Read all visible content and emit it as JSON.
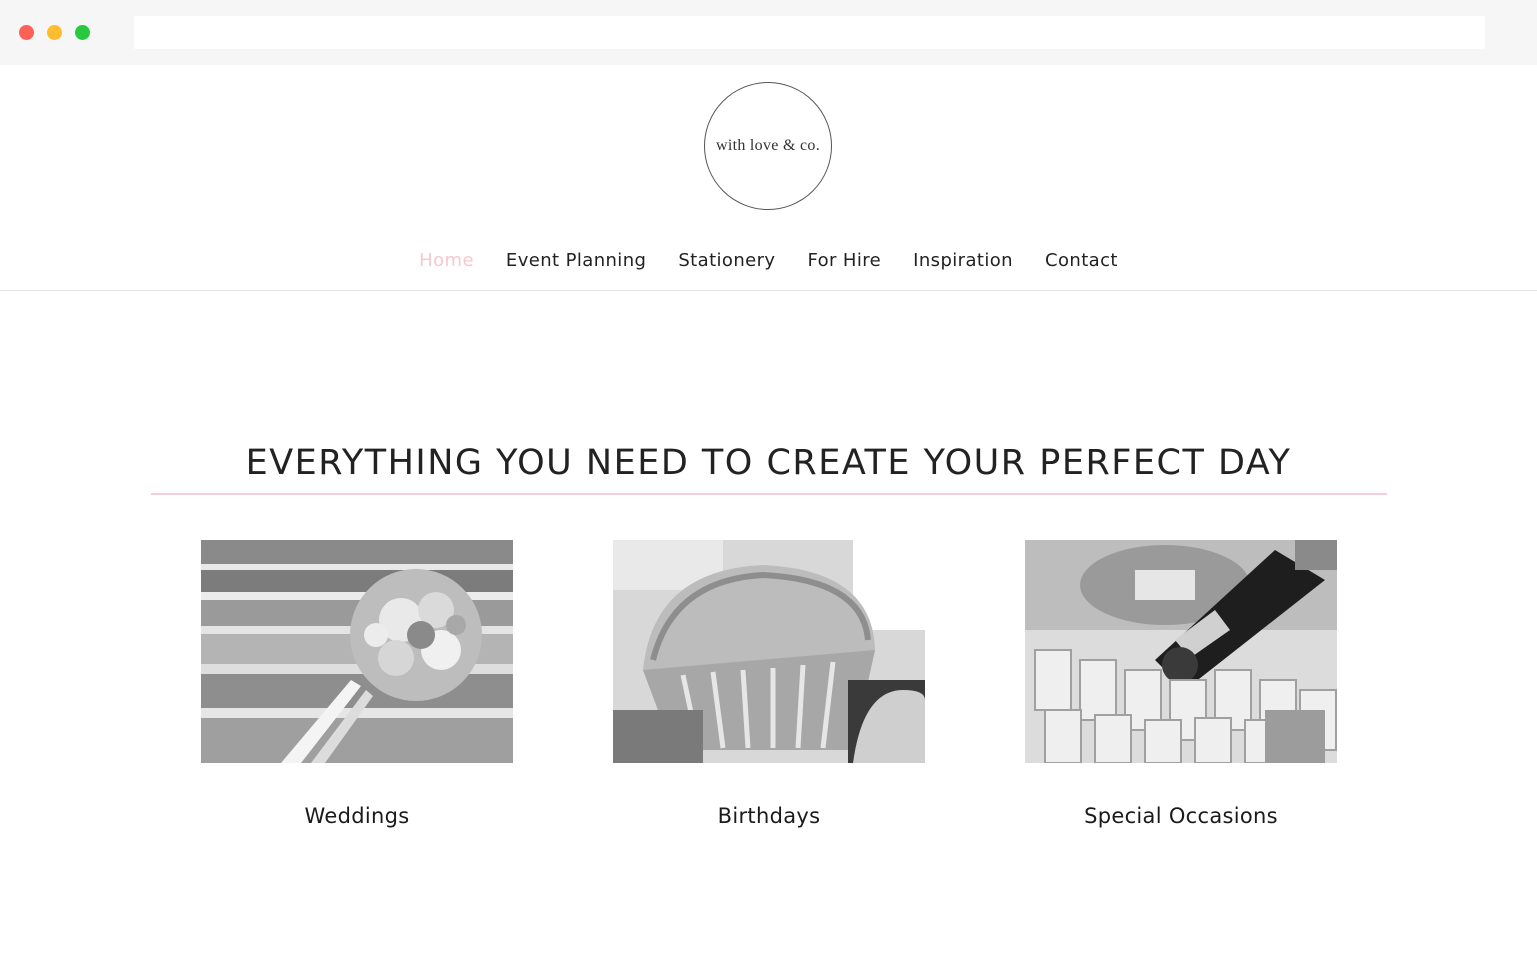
{
  "logo": {
    "text": "with love & co."
  },
  "nav": {
    "items": [
      "Home",
      "Event Planning",
      "Stationery",
      "For Hire",
      "Inspiration",
      "Contact"
    ],
    "active_index": 0,
    "active_color": "#f6c8d1"
  },
  "hero": {
    "headline": "EVERYTHING YOU NEED TO CREATE YOUR PERFECT DAY",
    "rule_color": "#f6cdd6"
  },
  "cards": [
    {
      "label": "Weddings",
      "image": "bouquet-photo"
    },
    {
      "label": "Birthdays",
      "image": "cupcake-photo"
    },
    {
      "label": "Special Occasions",
      "image": "champagne-glasses-photo"
    }
  ]
}
